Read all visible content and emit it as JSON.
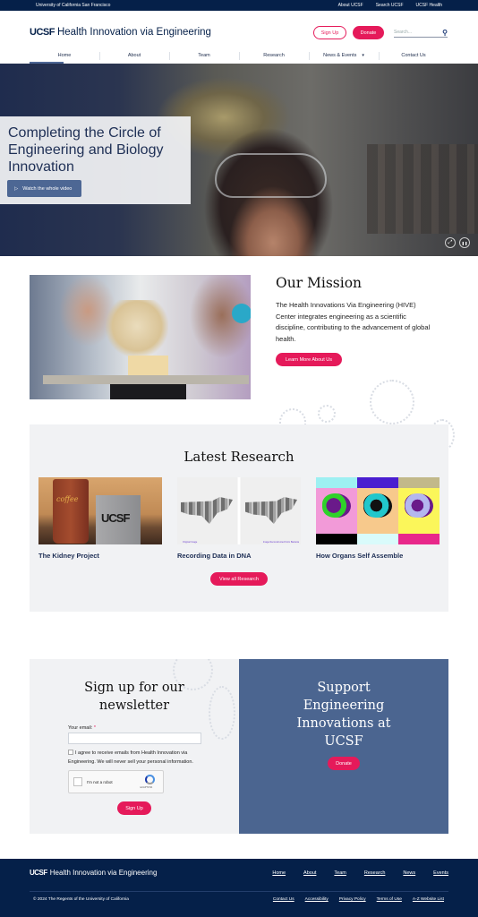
{
  "utility_bar": {
    "org_name": "University of California San Francisco",
    "links": [
      "About UCSF",
      "Search UCSF",
      "UCSF Health"
    ]
  },
  "header": {
    "logo_mark": "UCSF",
    "site_name": "Health Innovation via Engineering",
    "signup_label": "Sign Up",
    "donate_label": "Donate",
    "search_placeholder": "Search...",
    "search_icon": "magnifier-icon"
  },
  "nav": {
    "items": [
      {
        "label": "Home",
        "active": true
      },
      {
        "label": "About"
      },
      {
        "label": "Team"
      },
      {
        "label": "Research"
      },
      {
        "label": "News & Events",
        "has_dropdown": true
      },
      {
        "label": "Contact Us"
      }
    ],
    "dropdown_caret": "▾"
  },
  "hero": {
    "heading": "Completing the Circle of Engineering and Biology Innovation",
    "watch_label": "Watch the whole video",
    "play_icon": "▷",
    "expand_icon": "⤢",
    "pause_icon": "❚❚"
  },
  "mission": {
    "heading": "Our Mission",
    "body": "The Health Innovations Via Engineering (HIVE) Center integrates engineering as a scientific discipline, contributing to the advancement of global health.",
    "cta_label": "Learn More About Us"
  },
  "research": {
    "heading": "Latest Research",
    "cards": [
      {
        "title": "The Kidney Project",
        "cup_text": "coffee",
        "box_text": "UCSF"
      },
      {
        "title": "Recording Data in DNA",
        "caption_left": "Original Image",
        "caption_right": "Image Reconstructed From Bacteria"
      },
      {
        "title": "How Organs Self Assemble"
      }
    ],
    "cta_label": "View all Research"
  },
  "newsletter": {
    "heading": "Sign up for our newsletter",
    "email_label": "Your email:",
    "required_marker": "*",
    "email_value": "",
    "agree_text": "I agree to receive emails from Health Innovation via Engineering. We will never sell your personal information.",
    "captcha_label": "I'm not a robot",
    "captcha_brand": "reCAPTCHA",
    "captcha_links": "Privacy - Terms",
    "submit_label": "Sign Up"
  },
  "support": {
    "heading": "Support Engineering Innovations at UCSF",
    "donate_label": "Donate"
  },
  "footer": {
    "logo_mark": "UCSF",
    "site_name": "Health Innovation via Engineering",
    "nav": [
      "Home",
      "About",
      "Team",
      "Research",
      "News",
      "Events"
    ],
    "copyright": "© 2024 The Regents of the University of California",
    "legal_links": [
      "Contact Us",
      "Accessibility",
      "Privacy Policy",
      "Terms of Use",
      "A-Z Website List"
    ]
  },
  "colors": {
    "navy": "#052049",
    "accent_pink": "#e51a5a",
    "slate_blue": "#4b6590",
    "panel_gray": "#f1f2f4"
  }
}
